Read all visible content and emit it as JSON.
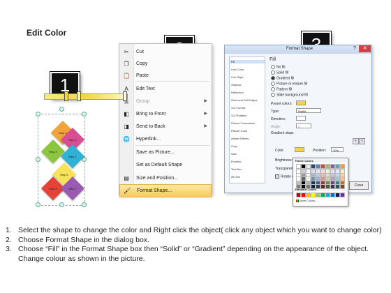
{
  "title": "Edit Color",
  "badges": [
    "1",
    "2",
    "3"
  ],
  "puzzle": {
    "pieces": [
      {
        "label": "Step 3",
        "color": "#f2a33a"
      },
      {
        "label": "Step 2",
        "color": "#d94d92"
      },
      {
        "label": "Step 4",
        "color": "#8cc63f"
      },
      {
        "label": "Step 1",
        "color": "#2eb2d8"
      },
      {
        "label": "Step 5",
        "color": "#f7e35a"
      },
      {
        "label": "Step 6",
        "color": "#e64338"
      },
      {
        "label": "Step 7",
        "color": "#9b5bb3"
      }
    ]
  },
  "context_menu": {
    "items": [
      {
        "label": "Cut",
        "icon": "scissors-icon",
        "glyph": "✂",
        "disabled": false
      },
      {
        "label": "Copy",
        "icon": "copy-icon",
        "glyph": "❐",
        "disabled": false
      },
      {
        "label": "Paste",
        "icon": "paste-icon",
        "glyph": "📋",
        "disabled": false
      },
      {
        "label": "Edit Text",
        "icon": "edit-text-icon",
        "glyph": "A",
        "disabled": false
      },
      {
        "label": "Group",
        "icon": "group-icon",
        "glyph": "▣",
        "disabled": true,
        "submenu": true
      },
      {
        "label": "Bring to Front",
        "icon": "bring-front-icon",
        "glyph": "◧",
        "disabled": false,
        "submenu": true
      },
      {
        "label": "Send to Back",
        "icon": "send-back-icon",
        "glyph": "◨",
        "disabled": false,
        "submenu": true
      },
      {
        "label": "Hyperlink...",
        "icon": "hyperlink-icon",
        "glyph": "🌐",
        "disabled": false
      },
      {
        "label": "Save as Picture...",
        "icon": "",
        "glyph": "",
        "disabled": false
      },
      {
        "label": "Set as Default Shape",
        "icon": "",
        "glyph": "",
        "disabled": false
      },
      {
        "label": "Size and Position...",
        "icon": "size-position-icon",
        "glyph": "▤",
        "disabled": false
      },
      {
        "label": "Format Shape...",
        "icon": "format-shape-icon",
        "glyph": "🖌",
        "disabled": false,
        "highlighted": true
      }
    ]
  },
  "format_dialog": {
    "title": "Format Shape",
    "help": "?",
    "close_x": "✕",
    "categories": [
      "Fill",
      "Line Color",
      "Line Style",
      "Shadow",
      "Reflection",
      "Glow and Soft Edges",
      "3-D Format",
      "3-D Rotation",
      "Picture Corrections",
      "Picture Color",
      "Artistic Effects",
      "Crop",
      "Size",
      "Position",
      "Text Box",
      "Alt Text"
    ],
    "selected_category": "Fill",
    "pane_title": "Fill",
    "fill_options": [
      "No fill",
      "Solid fill",
      "Gradient fill",
      "Picture or texture fill",
      "Pattern fill",
      "Slide background fill"
    ],
    "fill_selected_index": 2,
    "preset_colors_label": "Preset colors:",
    "type_label": "Type:",
    "type_value": "Radial",
    "direction_label": "Direction:",
    "angle_label": "Angle:",
    "angle_value": "0°",
    "gradient_stops_label": "Gradient stops",
    "color_label": "Color",
    "position_label": "Position:",
    "position_value": "30%",
    "brightness_label": "Brightness:",
    "transparency_label": "Transparency:",
    "rotate_label": "Rotate with shape",
    "close_button": "Close",
    "accent_color": "#f6d34a"
  },
  "color_picker": {
    "theme_label": "Theme Colors",
    "standard_label": "Standard Colors",
    "more_label": "More Colors...",
    "theme_columns": [
      "#ffffff",
      "#000000",
      "#eeece1",
      "#1f497d",
      "#4f81bd",
      "#c0504d",
      "#9bbb59",
      "#8064a2",
      "#4bacc6",
      "#f79646"
    ],
    "standard": [
      "#c00000",
      "#ff0000",
      "#ffc000",
      "#ffff00",
      "#92d050",
      "#00b050",
      "#00b0f0",
      "#0070c0",
      "#002060",
      "#7030a0"
    ]
  },
  "instructions": [
    {
      "num": "1.",
      "text": "Select the shape to change the color and Right click the object( click any object which you want to change color)"
    },
    {
      "num": "2.",
      "text": "Choose Format Shape in the dialog box."
    },
    {
      "num": "3.",
      "text": "Choose “Fill” in the Format Shape box then “Solid” or “Gradient” depending on the appearance of the object. Change colour as shown in the picture."
    }
  ]
}
